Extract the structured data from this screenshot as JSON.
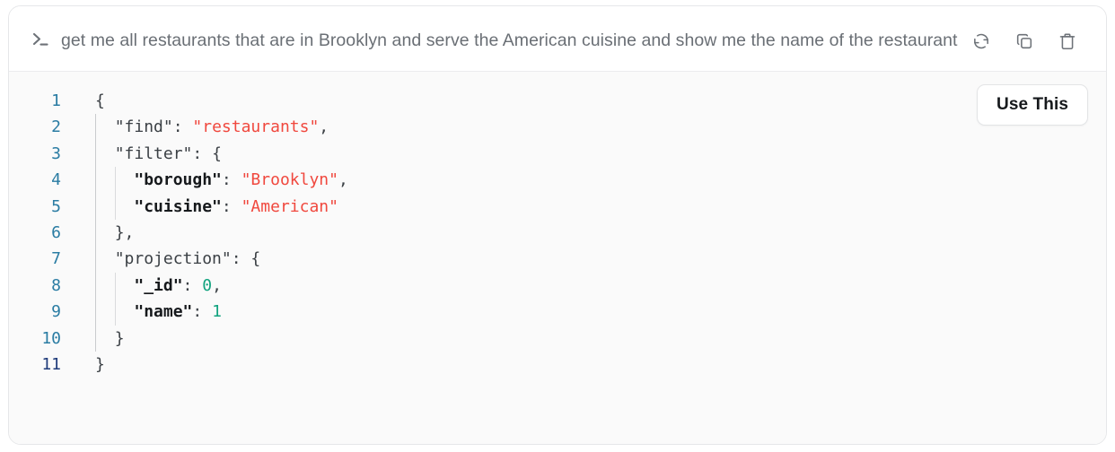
{
  "card": {
    "prompt": {
      "icon": "terminal-prompt-icon",
      "text": "get me all restaurants that are in Brooklyn and serve the American cuisine and show me the name of the restaurant"
    },
    "actions": [
      {
        "name": "regenerate-icon",
        "label": "Regenerate"
      },
      {
        "name": "copy-icon",
        "label": "Copy"
      },
      {
        "name": "delete-icon",
        "label": "Delete"
      }
    ],
    "use_this_label": "Use This",
    "code": {
      "language": "json",
      "lines": [
        {
          "num": "1",
          "text": "{"
        },
        {
          "num": "2",
          "text": "  \"find\": \"restaurants\","
        },
        {
          "num": "3",
          "text": "  \"filter\": {"
        },
        {
          "num": "4",
          "text": "    \"borough\": \"Brooklyn\","
        },
        {
          "num": "5",
          "text": "    \"cuisine\": \"American\""
        },
        {
          "num": "6",
          "text": "  },"
        },
        {
          "num": "7",
          "text": "  \"projection\": {"
        },
        {
          "num": "8",
          "text": "    \"_id\": 0,"
        },
        {
          "num": "9",
          "text": "    \"name\": 1"
        },
        {
          "num": "10",
          "text": "  }"
        },
        {
          "num": "11",
          "text": "}"
        }
      ],
      "raw": "{\n  \"find\": \"restaurants\",\n  \"filter\": {\n    \"borough\": \"Brooklyn\",\n    \"cuisine\": \"American\"\n  },\n  \"projection\": {\n    \"_id\": 0,\n    \"name\": 1\n  }\n}"
    },
    "colors": {
      "string": "#f0483e",
      "number": "#11a37f",
      "key_nested": "#16191c",
      "key_top": "#3b4045",
      "line_number": "#2a7ca3",
      "line_number_last": "#1f3b7a",
      "code_background": "#fafafa",
      "card_border": "#e6e7e9",
      "prompt_text": "#6a6f75"
    }
  }
}
